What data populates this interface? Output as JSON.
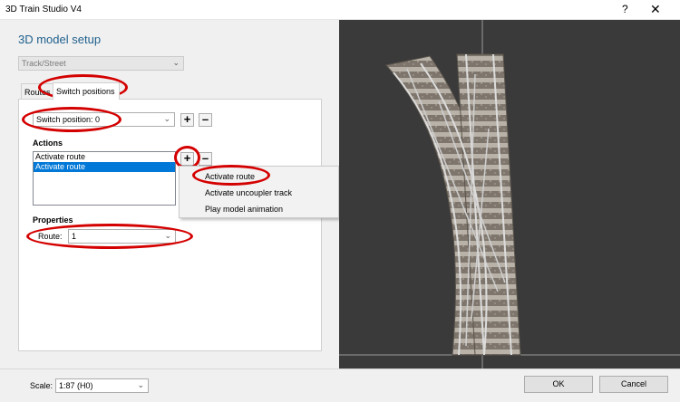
{
  "window": {
    "title": "3D Train Studio V4",
    "help_label": "?",
    "close_label": "✕"
  },
  "heading": "3D model setup",
  "category_select": {
    "value": "Track/Street"
  },
  "tabs": [
    {
      "label": "Routes"
    },
    {
      "label": "Switch positions"
    }
  ],
  "switch_position": {
    "value": "Switch position: 0"
  },
  "actions": {
    "label": "Actions",
    "items": [
      {
        "label": "Activate route"
      },
      {
        "label": "Activate route"
      }
    ]
  },
  "buttons": {
    "plus": "+",
    "minus": "–"
  },
  "context_menu": {
    "items": [
      {
        "label": "Activate route"
      },
      {
        "label": "Activate uncoupler track"
      },
      {
        "label": "Play model animation"
      }
    ]
  },
  "properties": {
    "label": "Properties",
    "route_label": "Route:",
    "route_value": "1"
  },
  "bottom": {
    "scale_label": "Scale:",
    "scale_value": "1:87 (H0)",
    "ok_label": "OK",
    "cancel_label": "Cancel"
  },
  "colors": {
    "accent": "#1e5f8c",
    "highlight": "#d40000",
    "selection": "#0078d7",
    "viewport_bg": "#3a3a3a"
  }
}
